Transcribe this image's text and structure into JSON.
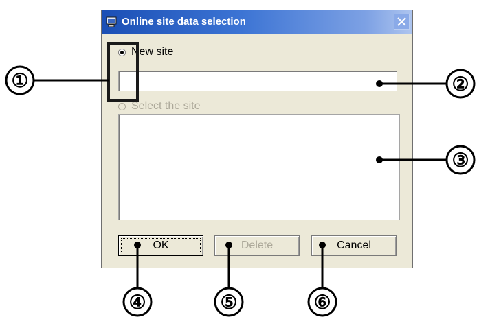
{
  "dialog": {
    "title": "Online site data selection",
    "close_icon": "close-icon",
    "window_icon": "monitor-icon"
  },
  "options": {
    "new_site": {
      "label": "New site",
      "selected": true,
      "enabled": true
    },
    "select_site": {
      "label": "Select the site",
      "selected": false,
      "enabled": false
    }
  },
  "site_name_input": {
    "value": ""
  },
  "site_list": {
    "items": []
  },
  "buttons": {
    "ok": {
      "label": "OK",
      "enabled": true
    },
    "delete": {
      "label": "Delete",
      "enabled": false
    },
    "cancel": {
      "label": "Cancel",
      "enabled": true
    }
  },
  "callouts": [
    "①",
    "②",
    "③",
    "④",
    "⑤",
    "⑥"
  ],
  "colors": {
    "titlebar": "#1b4fb5",
    "dialog_bg": "#ece9d8",
    "disabled_text": "#aca899"
  }
}
